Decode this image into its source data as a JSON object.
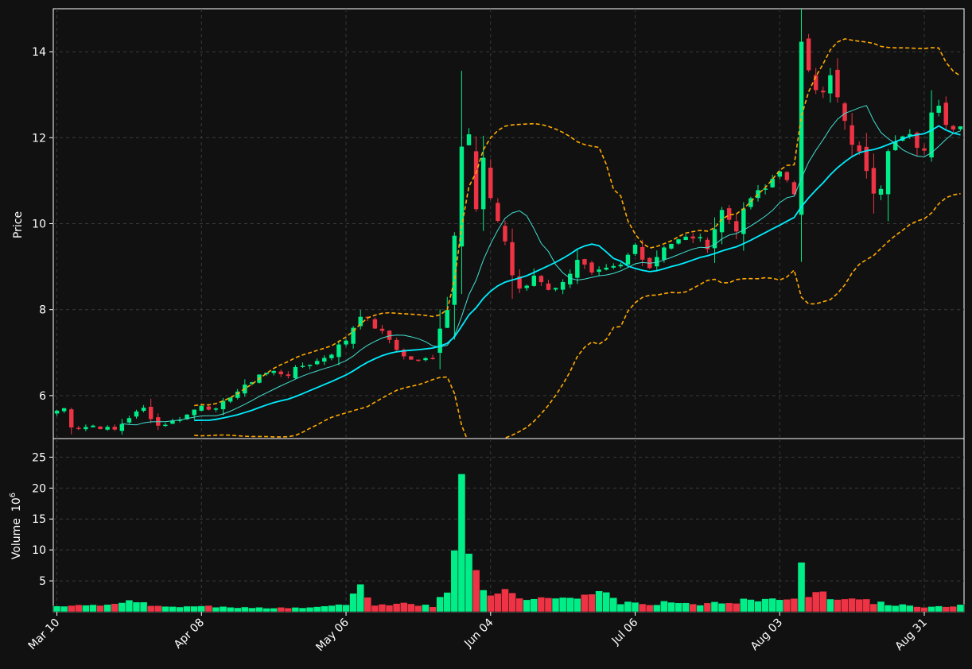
{
  "chart_data": {
    "type": "candlestick",
    "price_panel": {
      "ylabel": "Price",
      "ylim": [
        5.0,
        15.0
      ],
      "yticks": [
        6,
        8,
        10,
        12,
        14
      ],
      "grid": true
    },
    "volume_panel": {
      "ylabel": "Volume",
      "unit_exponent": "10",
      "unit_power": "6",
      "ylim": [
        0,
        28
      ],
      "yticks": [
        5,
        10,
        15,
        20,
        25
      ],
      "grid": true
    },
    "x_tick_labels": [
      "Mar 10",
      "Apr 08",
      "May 06",
      "Jun 04",
      "Jul 06",
      "Aug 03",
      "Aug 31"
    ],
    "x_tick_index": [
      0,
      20,
      40,
      60,
      80,
      100,
      120
    ],
    "bar_count": 126,
    "colors": {
      "background": "#111111",
      "up": "#00ee88",
      "down": "#ee3344",
      "ma_short": "#40e0d0",
      "ma_long": "#00eeff",
      "band": "#ffaa00",
      "axis": "#ffffff"
    },
    "close_anchors": [
      [
        0,
        5.65
      ],
      [
        1,
        5.7
      ],
      [
        2,
        5.3
      ],
      [
        3,
        5.25
      ],
      [
        5,
        5.3
      ],
      [
        8,
        5.2
      ],
      [
        10,
        5.5
      ],
      [
        12,
        5.7
      ],
      [
        14,
        5.3
      ],
      [
        16,
        5.4
      ],
      [
        18,
        5.55
      ],
      [
        20,
        5.8
      ],
      [
        22,
        5.65
      ],
      [
        24,
        6.0
      ],
      [
        26,
        6.2
      ],
      [
        28,
        6.5
      ],
      [
        30,
        6.55
      ],
      [
        32,
        6.5
      ],
      [
        34,
        6.7
      ],
      [
        36,
        6.8
      ],
      [
        38,
        7.0
      ],
      [
        40,
        7.3
      ],
      [
        42,
        7.9
      ],
      [
        44,
        7.6
      ],
      [
        46,
        7.3
      ],
      [
        48,
        6.9
      ],
      [
        50,
        6.8
      ],
      [
        52,
        6.9
      ],
      [
        53,
        7.6
      ],
      [
        54,
        8.0
      ],
      [
        55,
        9.8
      ],
      [
        56,
        11.9
      ],
      [
        57,
        12.1
      ],
      [
        58,
        10.3
      ],
      [
        59,
        11.5
      ],
      [
        60,
        10.5
      ],
      [
        61,
        10.1
      ],
      [
        62,
        9.6
      ],
      [
        63,
        8.8
      ],
      [
        64,
        8.5
      ],
      [
        65,
        8.5
      ],
      [
        66,
        8.8
      ],
      [
        68,
        8.5
      ],
      [
        70,
        8.6
      ],
      [
        72,
        9.2
      ],
      [
        74,
        8.8
      ],
      [
        76,
        8.9
      ],
      [
        78,
        9.0
      ],
      [
        80,
        9.5
      ],
      [
        82,
        9.0
      ],
      [
        84,
        9.5
      ],
      [
        86,
        9.6
      ],
      [
        88,
        9.7
      ],
      [
        90,
        9.5
      ],
      [
        92,
        10.3
      ],
      [
        94,
        9.9
      ],
      [
        96,
        10.6
      ],
      [
        98,
        10.8
      ],
      [
        100,
        11.3
      ],
      [
        102,
        10.6
      ],
      [
        103,
        14.3
      ],
      [
        104,
        13.7
      ],
      [
        105,
        13.2
      ],
      [
        106,
        13.0
      ],
      [
        107,
        13.4
      ],
      [
        108,
        12.9
      ],
      [
        109,
        12.3
      ],
      [
        110,
        11.9
      ],
      [
        112,
        11.3
      ],
      [
        113,
        10.8
      ],
      [
        114,
        10.9
      ],
      [
        115,
        11.8
      ],
      [
        116,
        11.9
      ],
      [
        118,
        12.0
      ],
      [
        120,
        11.7
      ],
      [
        121,
        12.7
      ],
      [
        122,
        12.8
      ],
      [
        123,
        12.3
      ],
      [
        124,
        12.3
      ],
      [
        125,
        12.3
      ]
    ],
    "volume_anchors": [
      [
        0,
        1.1
      ],
      [
        5,
        1.0
      ],
      [
        10,
        1.6
      ],
      [
        15,
        0.9
      ],
      [
        20,
        0.9
      ],
      [
        25,
        0.8
      ],
      [
        30,
        0.6
      ],
      [
        35,
        0.7
      ],
      [
        40,
        1.2
      ],
      [
        42,
        3.9
      ],
      [
        44,
        1.1
      ],
      [
        48,
        1.4
      ],
      [
        52,
        1.0
      ],
      [
        53,
        2.2
      ],
      [
        54,
        3.4
      ],
      [
        55,
        10.5
      ],
      [
        56,
        26.0
      ],
      [
        57,
        10.5
      ],
      [
        58,
        7.5
      ],
      [
        59,
        3.0
      ],
      [
        62,
        3.3
      ],
      [
        65,
        2.0
      ],
      [
        70,
        2.5
      ],
      [
        72,
        2.0
      ],
      [
        75,
        3.5
      ],
      [
        78,
        1.5
      ],
      [
        80,
        1.3
      ],
      [
        85,
        1.5
      ],
      [
        90,
        1.3
      ],
      [
        95,
        1.8
      ],
      [
        100,
        2.0
      ],
      [
        102,
        2.5
      ],
      [
        103,
        9.5
      ],
      [
        104,
        2.8
      ],
      [
        105,
        3.2
      ],
      [
        108,
        2.0
      ],
      [
        112,
        1.8
      ],
      [
        115,
        1.2
      ],
      [
        120,
        0.9
      ],
      [
        125,
        1.0
      ]
    ],
    "moving_average_windows": [
      10,
      20
    ],
    "band_width_std": 2
  }
}
